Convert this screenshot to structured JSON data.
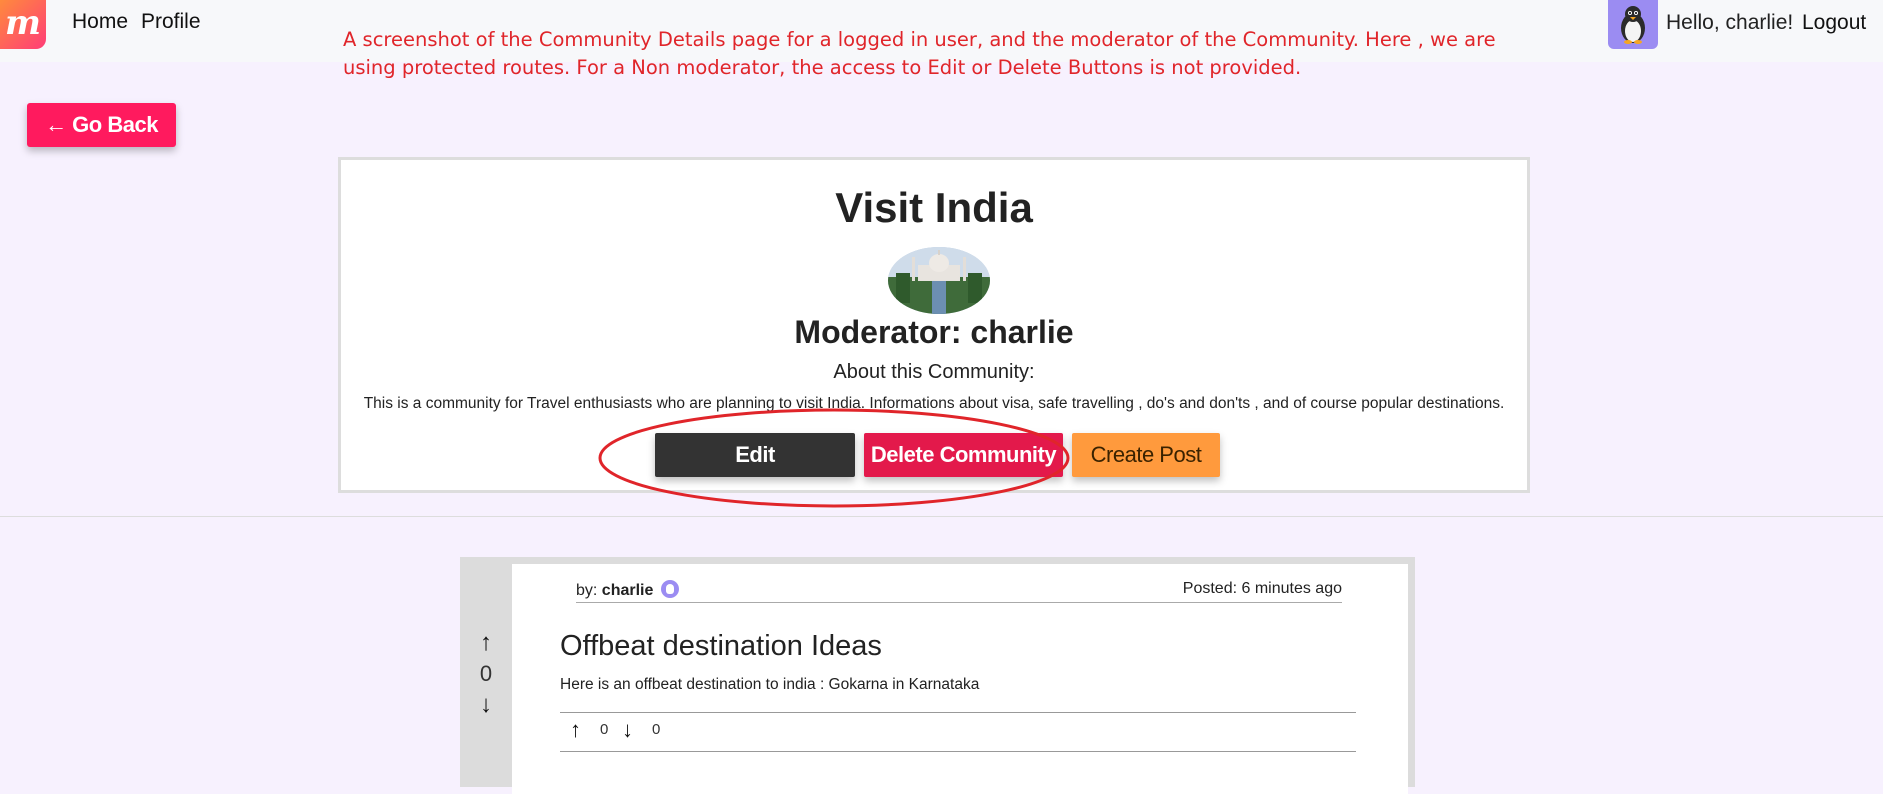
{
  "navbar": {
    "logo_letter": "m",
    "home_label": "Home",
    "profile_label": "Profile",
    "greeting": "Hello, charlie!",
    "logout_label": "Logout"
  },
  "annotation": "A screenshot of the Community Details page for a logged in user, and the moderator of the Community. Here , we are using protected routes. For a Non moderator, the access to Edit or Delete Buttons is not provided.",
  "go_back_label": "← Go Back",
  "community": {
    "title": "Visit India",
    "moderator": "Moderator: charlie",
    "about_label": "About this Community:",
    "description": "This is a community for Travel enthusiasts who are planning to visit India. Informations about visa, safe travelling , do's and don'ts , and of course popular destinations.",
    "edit_label": "Edit",
    "delete_label": "Delete Community",
    "create_post_label": "Create Post"
  },
  "post": {
    "by_prefix": "by:",
    "author": "charlie",
    "posted": "Posted: 6 minutes ago",
    "vote_count": "0",
    "title": "Offbeat destination Ideas",
    "body": "Here is an offbeat destination to india : Gokarna in Karnataka",
    "upvotes": "0",
    "downvotes": "0"
  },
  "colors": {
    "background": "#f7f1fe",
    "go_back": "#ff1a5e",
    "edit": "#333333",
    "delete": "#e3194b",
    "create_post": "#ff9a3d",
    "annotation": "#e0252a",
    "avatar": "#9b8cf2"
  }
}
